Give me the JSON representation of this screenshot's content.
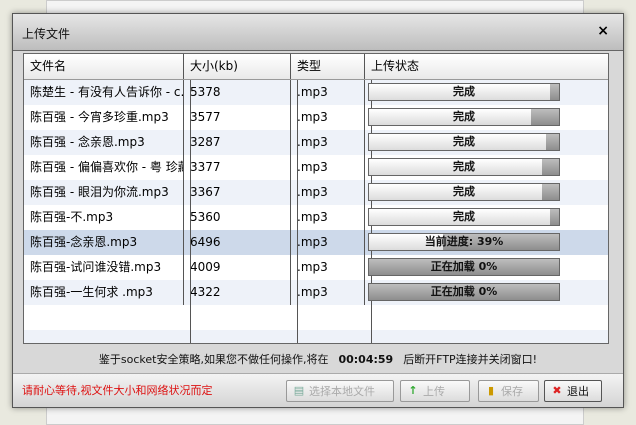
{
  "dialog": {
    "title": "上传文件",
    "close": "×"
  },
  "table": {
    "headers": [
      "文件名",
      "大小(kb)",
      "类型",
      "上传状态"
    ],
    "rows": [
      {
        "name": "陈楚生 - 有没有人告诉你 - c.",
        "size": "5378",
        "type": ".mp3",
        "status": "完成",
        "progress": 0.95
      },
      {
        "name": "陈百强 - 今宵多珍重.mp3",
        "size": "3577",
        "type": ".mp3",
        "status": "完成",
        "progress": 0.85
      },
      {
        "name": "陈百强 - 念亲恩.mp3",
        "size": "3287",
        "type": ".mp3",
        "status": "完成",
        "progress": 0.93
      },
      {
        "name": "陈百强 - 偏偏喜欢你 - 粤 珍藏",
        "size": "3377",
        "type": ".mp3",
        "status": "完成",
        "progress": 0.91
      },
      {
        "name": "陈百强 - 眼泪为你流.mp3",
        "size": "3367",
        "type": ".mp3",
        "status": "完成",
        "progress": 0.91
      },
      {
        "name": "陈百强-不.mp3",
        "size": "5360",
        "type": ".mp3",
        "status": "完成",
        "progress": 0.95
      },
      {
        "name": "陈百强-念亲恩.mp3",
        "size": "6496",
        "type": ".mp3",
        "status": "当前进度: 39%",
        "progress": 0.39
      },
      {
        "name": "陈百强-试问谁没错.mp3",
        "size": "4009",
        "type": ".mp3",
        "status": "正在加载 0%",
        "progress": 0
      },
      {
        "name": "陈百强-一生何求 .mp3",
        "size": "4322",
        "type": ".mp3",
        "status": "正在加载 0%",
        "progress": 0
      }
    ]
  },
  "notice": {
    "before": "鉴于socket安全策略,如果您不做任何操作,将在",
    "time": "00:04:59",
    "after": "后断开FTP连接并关闭窗口!"
  },
  "footer": {
    "warning": "请耐心等待,视文件大小和网络状况而定",
    "buttons": [
      {
        "label": "选择本地文件",
        "icon": "add-file-icon"
      },
      {
        "label": "上传",
        "icon": "up-arrow-icon"
      },
      {
        "label": "保存",
        "icon": "save-icon"
      },
      {
        "label": "退出",
        "icon": "close-x-icon"
      }
    ]
  }
}
